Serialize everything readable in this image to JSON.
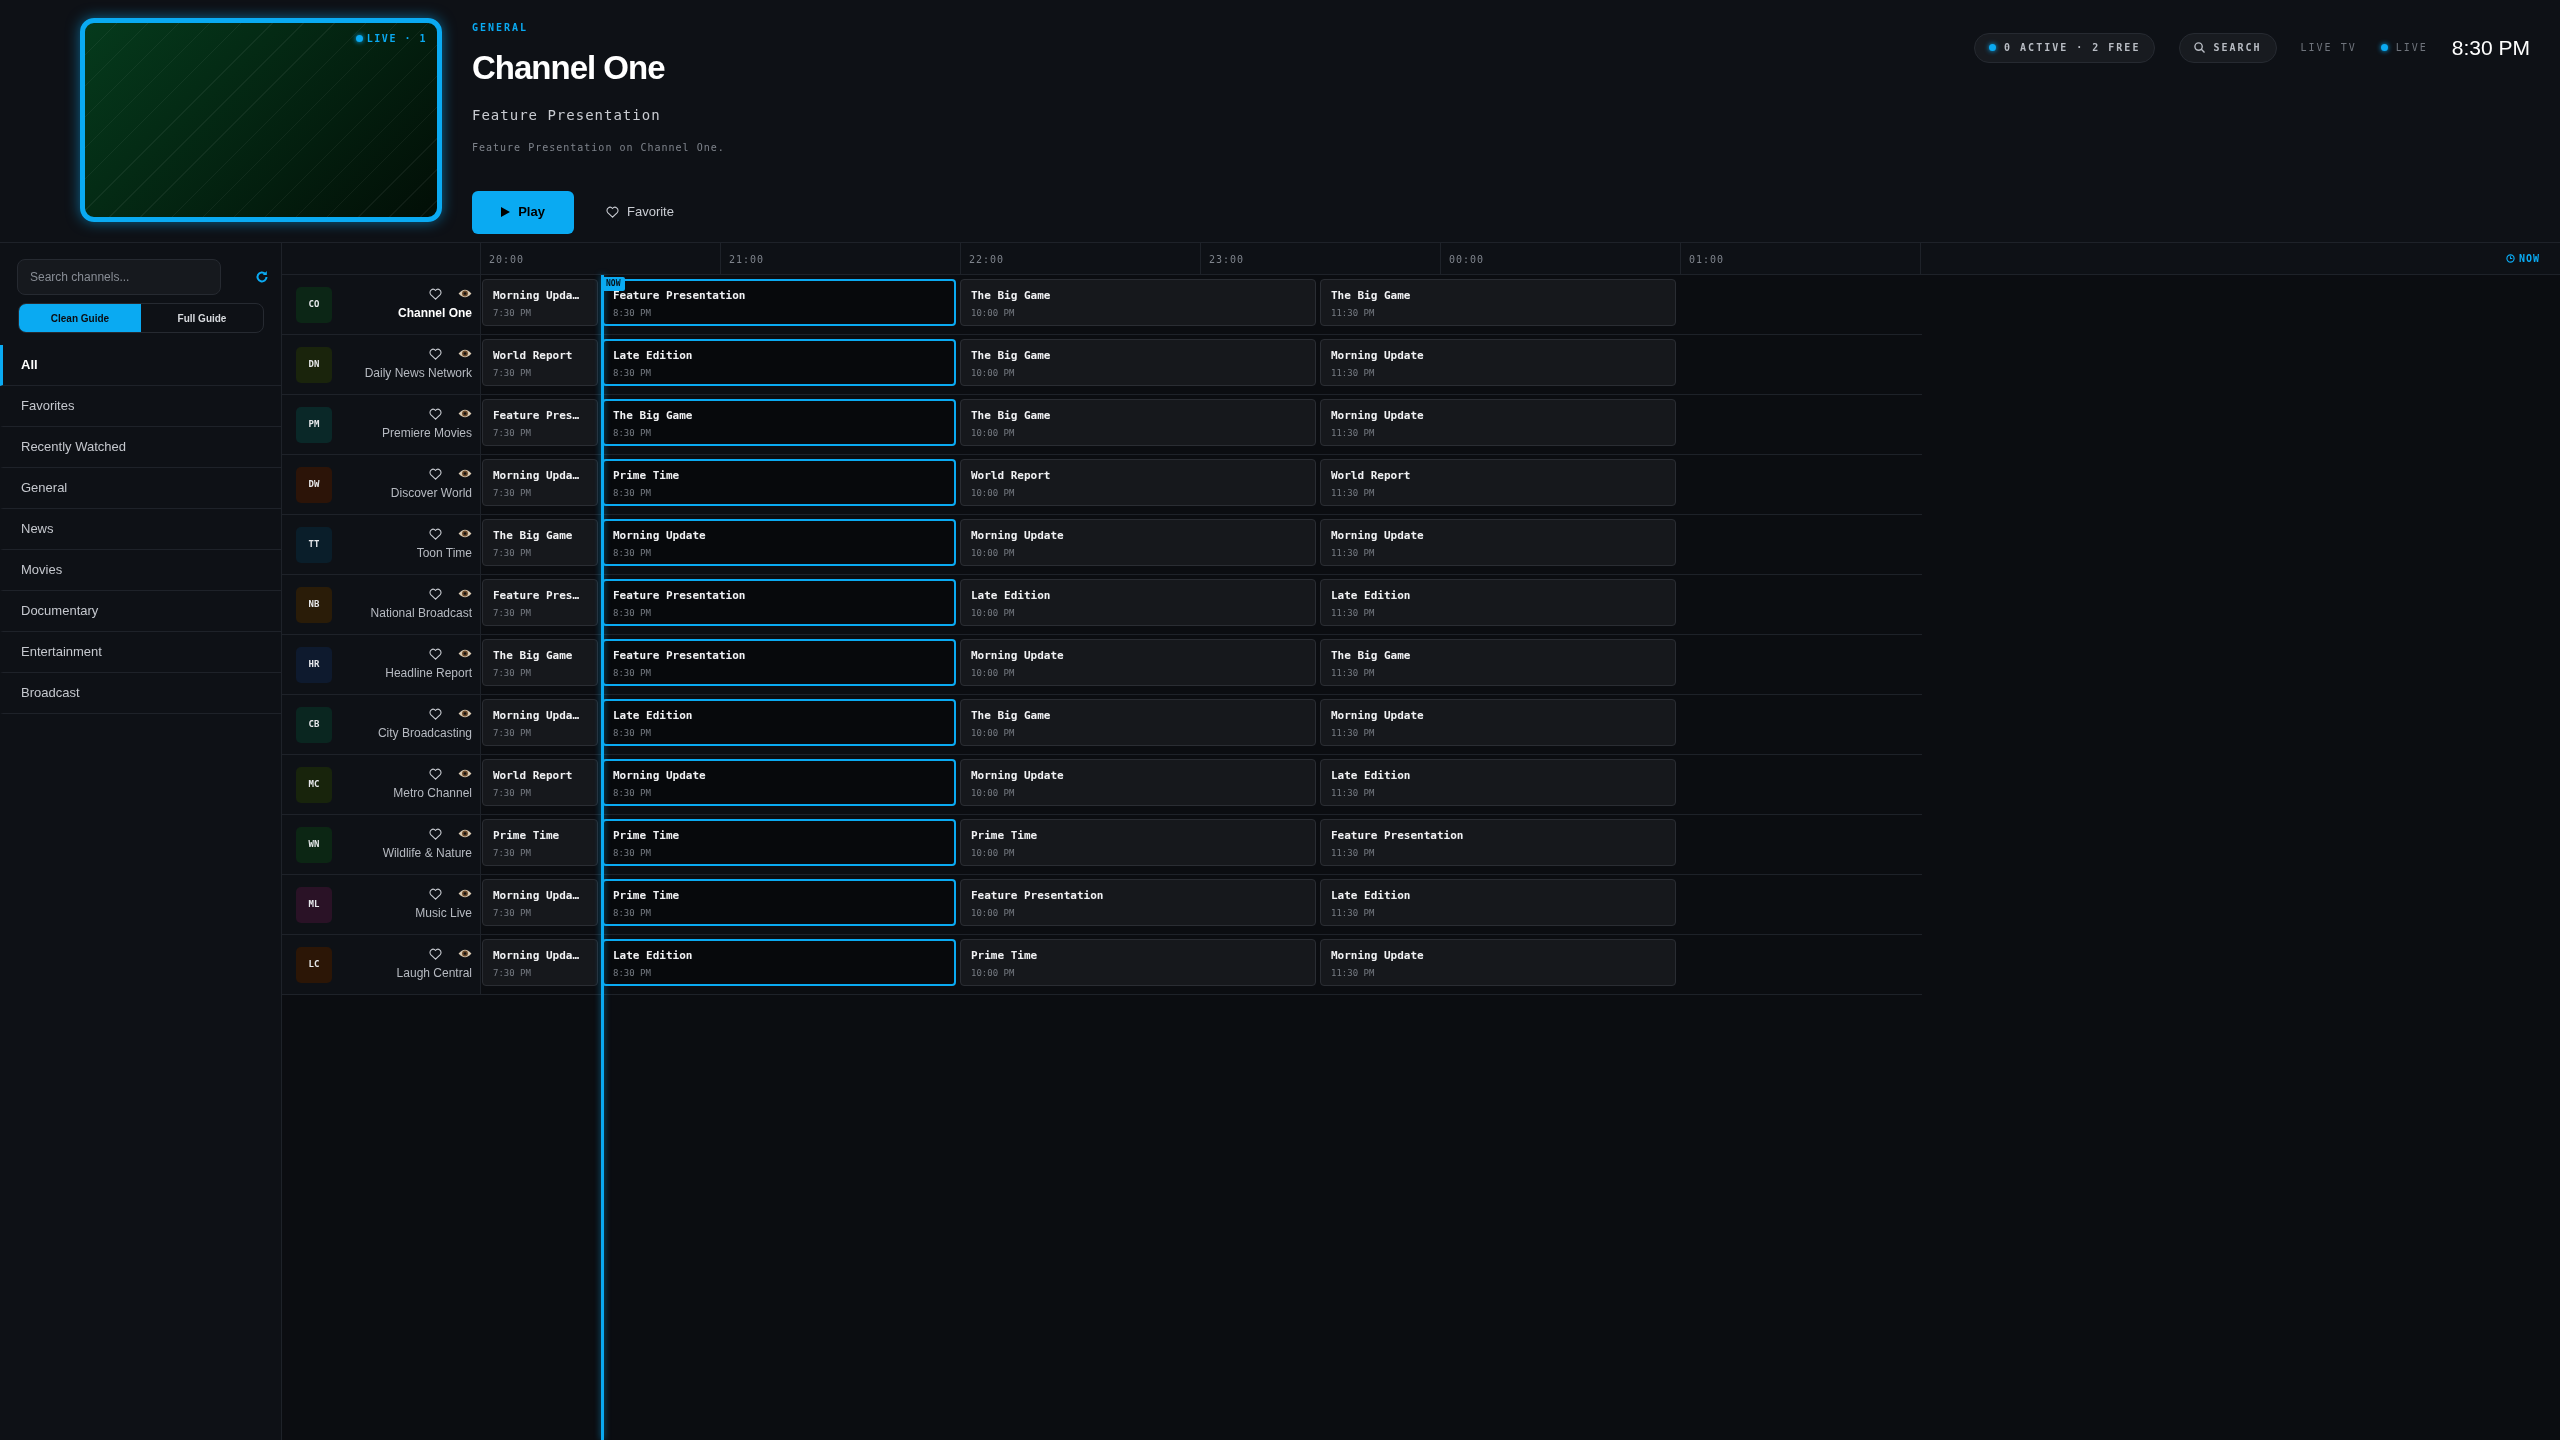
{
  "preview": {
    "badge": "LIVE · 1"
  },
  "header": {
    "category": "GENERAL",
    "title": "Channel One",
    "subtitle": "Feature Presentation",
    "description": "Feature Presentation on Channel One.",
    "play_button": "Play",
    "favorite_button": "Favorite"
  },
  "top_bar": {
    "status": "0 ACTIVE · 2 FREE",
    "search": "SEARCH",
    "section": "LIVE TV",
    "live": "LIVE",
    "clock": "8:30 PM"
  },
  "sidebar": {
    "search": {
      "placeholder": "Search channels..."
    },
    "guide_modes": [
      {
        "label": "Clean Guide",
        "selected": true
      },
      {
        "label": "Full Guide",
        "selected": false
      }
    ],
    "items": [
      {
        "label": "All",
        "selected": true
      },
      {
        "label": "Favorites",
        "selected": false
      },
      {
        "label": "Recently Watched",
        "selected": false
      },
      {
        "label": "General",
        "selected": false
      },
      {
        "label": "News",
        "selected": false
      },
      {
        "label": "Movies",
        "selected": false
      },
      {
        "label": "Documentary",
        "selected": false
      },
      {
        "label": "Entertainment",
        "selected": false
      },
      {
        "label": "Broadcast",
        "selected": false
      }
    ]
  },
  "timeline": {
    "hours": [
      "20:00",
      "21:00",
      "22:00",
      "23:00",
      "00:00",
      "01:00"
    ],
    "now_button": "NOW",
    "now_badge": "NOW"
  },
  "channels": [
    {
      "logo": "CO",
      "name": "Channel One",
      "color": "#0c2616",
      "selected": true,
      "programs": [
        {
          "title": "Morning Upda…",
          "time": "7:30 PM",
          "current": false
        },
        {
          "title": "Feature Presentation",
          "time": "8:30 PM",
          "current": true
        },
        {
          "title": "The Big Game",
          "time": "10:00 PM",
          "current": false
        },
        {
          "title": "The Big Game",
          "time": "11:30 PM",
          "current": false
        }
      ]
    },
    {
      "logo": "DN",
      "name": "Daily News Network",
      "color": "#1a240c",
      "selected": false,
      "programs": [
        {
          "title": "World Report",
          "time": "7:30 PM",
          "current": false
        },
        {
          "title": "Late Edition",
          "time": "8:30 PM",
          "current": true
        },
        {
          "title": "The Big Game",
          "time": "10:00 PM",
          "current": false
        },
        {
          "title": "Morning Update",
          "time": "11:30 PM",
          "current": false
        }
      ]
    },
    {
      "logo": "PM",
      "name": "Premiere Movies",
      "color": "#0a2828",
      "selected": false,
      "programs": [
        {
          "title": "Feature Pres…",
          "time": "7:30 PM",
          "current": false
        },
        {
          "title": "The Big Game",
          "time": "8:30 PM",
          "current": true
        },
        {
          "title": "The Big Game",
          "time": "10:00 PM",
          "current": false
        },
        {
          "title": "Morning Update",
          "time": "11:30 PM",
          "current": false
        }
      ]
    },
    {
      "logo": "DW",
      "name": "Discover World",
      "color": "#2c1408",
      "selected": false,
      "programs": [
        {
          "title": "Morning Upda…",
          "time": "7:30 PM",
          "current": false
        },
        {
          "title": "Prime Time",
          "time": "8:30 PM",
          "current": true
        },
        {
          "title": "World Report",
          "time": "10:00 PM",
          "current": false
        },
        {
          "title": "World Report",
          "time": "11:30 PM",
          "current": false
        }
      ]
    },
    {
      "logo": "TT",
      "name": "Toon Time",
      "color": "#0a1e2a",
      "selected": false,
      "programs": [
        {
          "title": "The Big Game",
          "time": "7:30 PM",
          "current": false
        },
        {
          "title": "Morning Update",
          "time": "8:30 PM",
          "current": true
        },
        {
          "title": "Morning Update",
          "time": "10:00 PM",
          "current": false
        },
        {
          "title": "Morning Update",
          "time": "11:30 PM",
          "current": false
        }
      ]
    },
    {
      "logo": "NB",
      "name": "National Broadcast",
      "color": "#2a1c08",
      "selected": false,
      "programs": [
        {
          "title": "Feature Pres…",
          "time": "7:30 PM",
          "current": false
        },
        {
          "title": "Feature Presentation",
          "time": "8:30 PM",
          "current": true
        },
        {
          "title": "Late Edition",
          "time": "10:00 PM",
          "current": false
        },
        {
          "title": "Late Edition",
          "time": "11:30 PM",
          "current": false
        }
      ]
    },
    {
      "logo": "HR",
      "name": "Headline Report",
      "color": "#0e1a2e",
      "selected": false,
      "programs": [
        {
          "title": "The Big Game",
          "time": "7:30 PM",
          "current": false
        },
        {
          "title": "Feature Presentation",
          "time": "8:30 PM",
          "current": true
        },
        {
          "title": "Morning Update",
          "time": "10:00 PM",
          "current": false
        },
        {
          "title": "The Big Game",
          "time": "11:30 PM",
          "current": false
        }
      ]
    },
    {
      "logo": "CB",
      "name": "City Broadcasting",
      "color": "#0a2620",
      "selected": false,
      "programs": [
        {
          "title": "Morning Upda…",
          "time": "7:30 PM",
          "current": false
        },
        {
          "title": "Late Edition",
          "time": "8:30 PM",
          "current": true
        },
        {
          "title": "The Big Game",
          "time": "10:00 PM",
          "current": false
        },
        {
          "title": "Morning Update",
          "time": "11:30 PM",
          "current": false
        }
      ]
    },
    {
      "logo": "MC",
      "name": "Metro Channel",
      "color": "#18240c",
      "selected": false,
      "programs": [
        {
          "title": "World Report",
          "time": "7:30 PM",
          "current": false
        },
        {
          "title": "Morning Update",
          "time": "8:30 PM",
          "current": true
        },
        {
          "title": "Morning Update",
          "time": "10:00 PM",
          "current": false
        },
        {
          "title": "Late Edition",
          "time": "11:30 PM",
          "current": false
        }
      ]
    },
    {
      "logo": "WN",
      "name": "Wildlife & Nature",
      "color": "#0c2614",
      "selected": false,
      "programs": [
        {
          "title": "Prime Time",
          "time": "7:30 PM",
          "current": false
        },
        {
          "title": "Prime Time",
          "time": "8:30 PM",
          "current": true
        },
        {
          "title": "Prime Time",
          "time": "10:00 PM",
          "current": false
        },
        {
          "title": "Feature Presentation",
          "time": "11:30 PM",
          "current": false
        }
      ]
    },
    {
      "logo": "ML",
      "name": "Music Live",
      "color": "#2a1226",
      "selected": false,
      "programs": [
        {
          "title": "Morning Upda…",
          "time": "7:30 PM",
          "current": false
        },
        {
          "title": "Prime Time",
          "time": "8:30 PM",
          "current": true
        },
        {
          "title": "Feature Presentation",
          "time": "10:00 PM",
          "current": false
        },
        {
          "title": "Late Edition",
          "time": "11:30 PM",
          "current": false
        }
      ]
    },
    {
      "logo": "LC",
      "name": "Laugh Central",
      "color": "#2c1606",
      "selected": false,
      "programs": [
        {
          "title": "Morning Upda…",
          "time": "7:30 PM",
          "current": false
        },
        {
          "title": "Late Edition",
          "time": "8:30 PM",
          "current": true
        },
        {
          "title": "Prime Time",
          "time": "10:00 PM",
          "current": false
        },
        {
          "title": "Morning Update",
          "time": "11:30 PM",
          "current": false
        }
      ]
    }
  ]
}
